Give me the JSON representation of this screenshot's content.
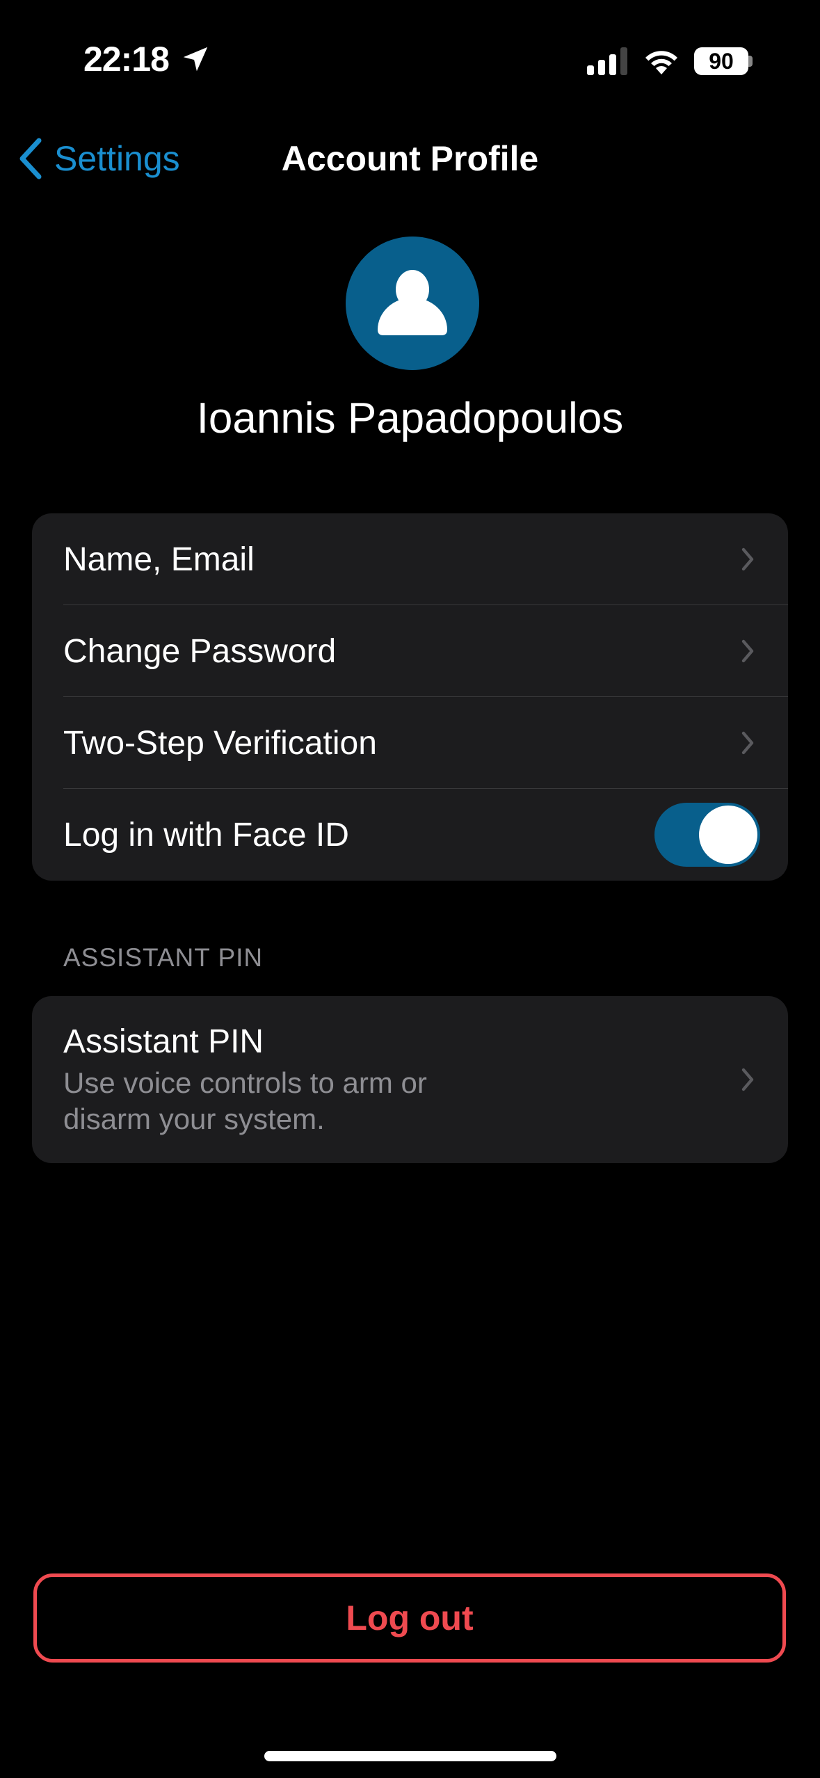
{
  "status_bar": {
    "time": "22:18",
    "location_icon": "location-arrow-icon",
    "signal_icon": "cellular-signal-icon",
    "wifi_icon": "wifi-icon",
    "battery_level": "90"
  },
  "nav": {
    "back_label": "Settings",
    "title": "Account Profile"
  },
  "profile": {
    "avatar_icon": "person-icon",
    "avatar_color": "#085f8c",
    "name": "Ioannis Papadopoulos"
  },
  "account_group": {
    "items": [
      {
        "label": "Name, Email",
        "accessory": "chevron"
      },
      {
        "label": "Change Password",
        "accessory": "chevron"
      },
      {
        "label": "Two-Step Verification",
        "accessory": "chevron"
      },
      {
        "label": "Log in with Face ID",
        "accessory": "toggle",
        "toggle_on": true
      }
    ]
  },
  "assistant_section": {
    "header": "ASSISTANT PIN",
    "item": {
      "title": "Assistant PIN",
      "subtitle": "Use voice controls to arm or disarm your system."
    }
  },
  "logout": {
    "label": "Log out",
    "color": "#ef4a50"
  },
  "accent_color": "#1a8fd0"
}
